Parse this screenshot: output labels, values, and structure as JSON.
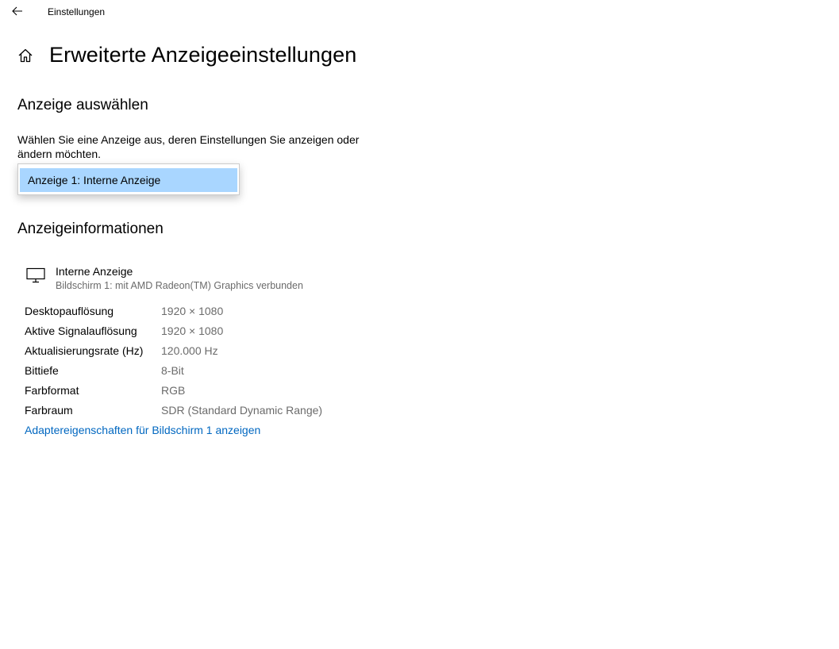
{
  "titlebar": {
    "app_title": "Einstellungen"
  },
  "header": {
    "title": "Erweiterte Anzeigeeinstellungen"
  },
  "select_display": {
    "heading": "Anzeige auswählen",
    "description": "Wählen Sie eine Anzeige aus, deren Einstellungen Sie anzeigen oder ändern möchten.",
    "dropdown_option": "Anzeige 1: Interne Anzeige"
  },
  "display_info": {
    "heading": "Anzeigeinformationen",
    "name": "Interne Anzeige",
    "subtitle": "Bildschirm 1: mit AMD Radeon(TM) Graphics verbunden",
    "rows": [
      {
        "label": "Desktopauflösung",
        "value": "1920 × 1080"
      },
      {
        "label": "Aktive Signalauflösung",
        "value": "1920 × 1080"
      },
      {
        "label": "Aktualisierungsrate (Hz)",
        "value": "120.000 Hz"
      },
      {
        "label": "Bittiefe",
        "value": "8-Bit"
      },
      {
        "label": "Farbformat",
        "value": "RGB"
      },
      {
        "label": "Farbraum",
        "value": "SDR (Standard Dynamic Range)"
      }
    ],
    "adapter_link": "Adaptereigenschaften für Bildschirm 1 anzeigen"
  },
  "icons": {
    "back": "back-arrow-icon",
    "home": "home-icon",
    "monitor": "monitor-icon"
  },
  "colors": {
    "accent_link": "#0067c0",
    "selection": "#a9d6ff",
    "secondary_text": "#6b6b6b"
  }
}
